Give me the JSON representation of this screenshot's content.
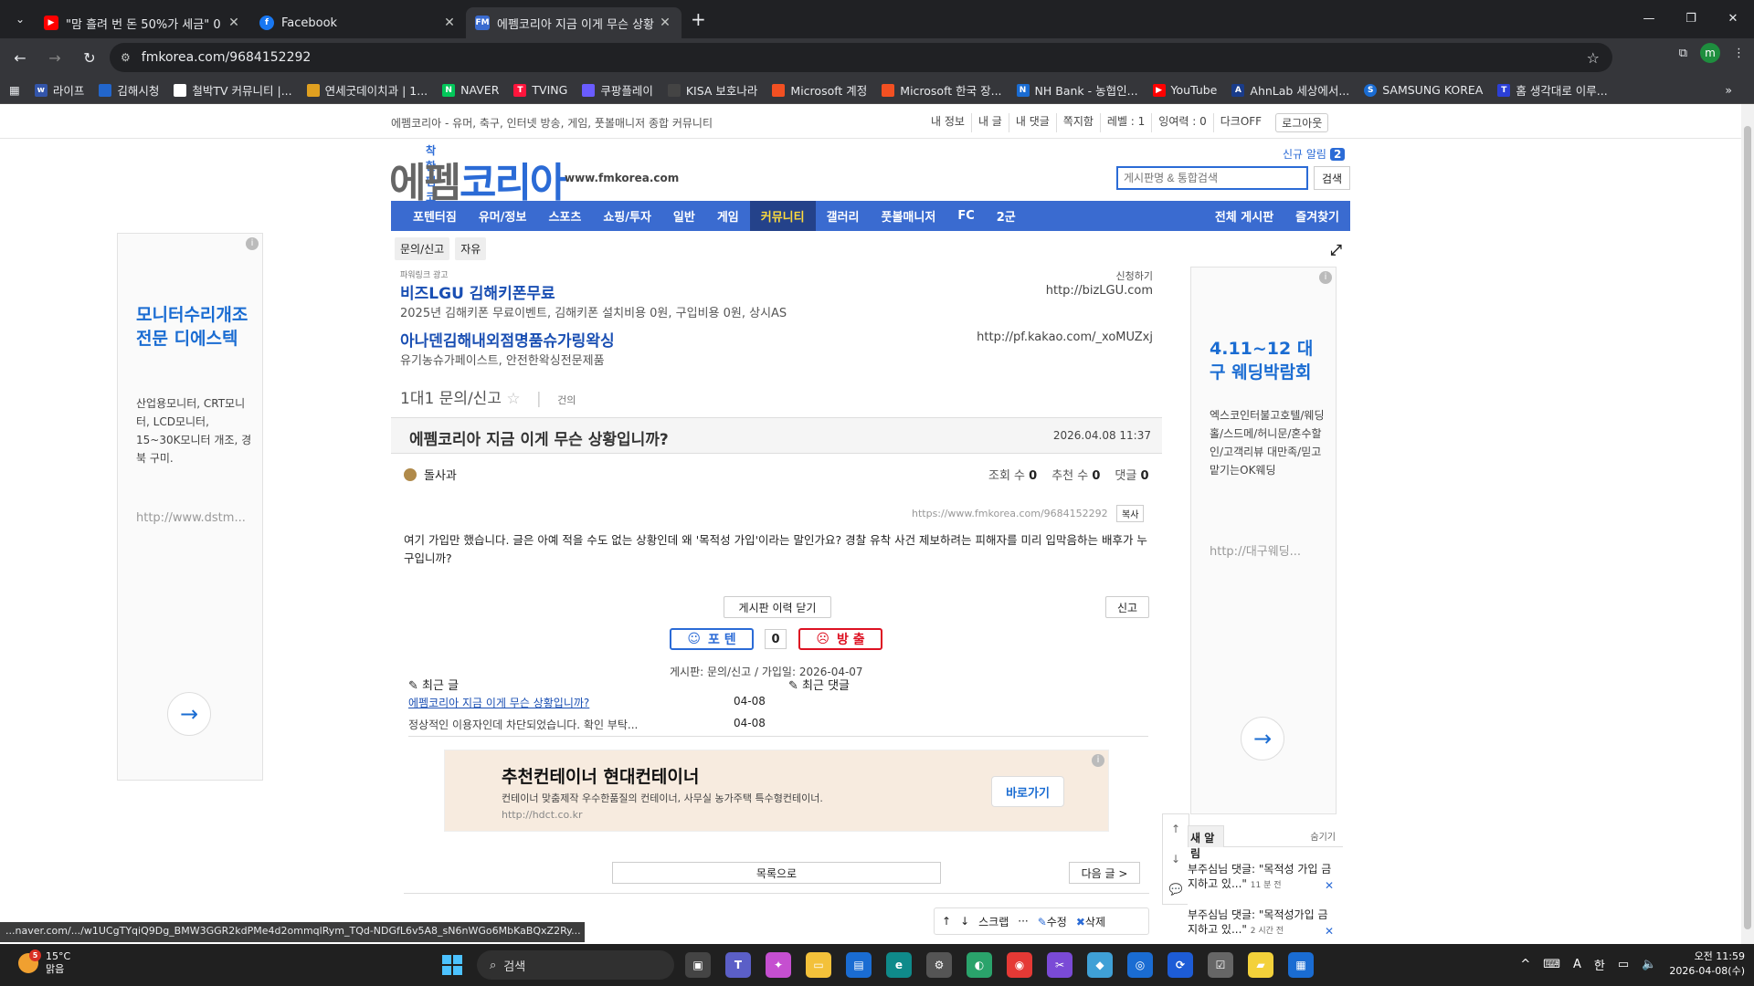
{
  "browser": {
    "tabs": [
      {
        "title": "\"맘 흘려 번 돈 50%가 세금\" 0",
        "icon": "youtube-icon",
        "color": "#ff0000"
      },
      {
        "title": "Facebook",
        "icon": "facebook-icon",
        "color": "#1877f2"
      },
      {
        "title": "에펨코리아 지금 이게 무슨 상황",
        "icon": "fmkorea-icon",
        "color": "#3a6bd0",
        "active": true
      }
    ],
    "url": "fmkorea.com/9684152292",
    "profile": "m",
    "bookmarks": [
      {
        "label": "라이프",
        "color": "#3355aa",
        "glyph": "ww"
      },
      {
        "label": "김해시청",
        "color": "#2266cc",
        "glyph": ""
      },
      {
        "label": "철박TV 커뮤니티 |...",
        "color": "#fff",
        "glyph": ""
      },
      {
        "label": "연세굿데이치과 | 1...",
        "color": "#e0a020",
        "glyph": ""
      },
      {
        "label": "NAVER",
        "color": "#03c75a",
        "glyph": "N"
      },
      {
        "label": "TVING",
        "color": "#ff153c",
        "glyph": "T"
      },
      {
        "label": "쿠팡플레이",
        "color": "#6a5cff",
        "glyph": ""
      },
      {
        "label": "KISA 보호나라",
        "color": "#444",
        "glyph": ""
      },
      {
        "label": "Microsoft 계정",
        "color": "#f25022",
        "glyph": ""
      },
      {
        "label": "Microsoft 한국  장...",
        "color": "#f25022",
        "glyph": ""
      },
      {
        "label": "NH Bank - 농협인...",
        "color": "#1a6cd2",
        "glyph": "NH"
      },
      {
        "label": "YouTube",
        "color": "#ff0000",
        "glyph": ""
      },
      {
        "label": "AhnLab  세상에서...",
        "color": "#1a3c8a",
        "glyph": "A"
      },
      {
        "label": "SAMSUNG KOREA",
        "color": "#1a6cd2",
        "glyph": "S"
      },
      {
        "label": "홈  생각대로 이루...",
        "color": "#2b3fd6",
        "glyph": "T"
      }
    ],
    "status_url": "...naver.com/.../w1UCgTYqiQ9Dg_BMW3GGR2kdPMe4d2ommqlRym_TQd-NDGfL6v5A8_sN6nWGo6MbKaBQxZ2Ry..."
  },
  "site": {
    "description": "에펨코리아 - 유머, 축구, 인터넷 방송, 게임, 풋볼매니저 종합 커뮤니티",
    "util_links": [
      "내 정보",
      "내 글",
      "내 댓글",
      "쪽지함",
      "레벨 : 1",
      "잉여력 : 0",
      "다크OFF"
    ],
    "logout": "로그아웃",
    "logo_small": "착한 펨코",
    "logo_part1": "에펨",
    "logo_part2": "코리아",
    "logo_url": "www.fmkorea.com",
    "new_alarm_label": "신규 알림",
    "new_alarm_count": "2",
    "search_placeholder": "게시판명 & 통합검색",
    "search_button": "검색",
    "gnb": [
      "포텐터짐",
      "유머/정보",
      "스포츠",
      "쇼핑/투자",
      "일반",
      "게임",
      "커뮤니티",
      "갤러리",
      "풋볼매니저",
      "FC",
      "2군"
    ],
    "gnb_active": "커뮤니티",
    "gnb_right": [
      "전체 게시판",
      "즐겨찾기"
    ],
    "subnav": [
      "문의/신고",
      "자유"
    ]
  },
  "powerlink": {
    "label": "파워링크 광고",
    "apply": "신청하기",
    "ads": [
      {
        "title": "비즈LGU 김해키폰무료",
        "desc": "2025년 김해키폰 무료이벤트, 김해키폰 설치비용 0원, 구입비용 0원, 상시AS",
        "url": "http://bizLGU.com"
      },
      {
        "title": "아나덴김해내외점명품슈가링왁싱",
        "desc": "유기농슈가페이스트, 안전한왁싱전문제품",
        "url": "http://pf.kakao.com/_xoMUZxj"
      }
    ]
  },
  "board": {
    "name": "1대1 문의/신고",
    "suggest": "건의"
  },
  "article": {
    "title": "에펨코리아 지금 이게 무슨 상황입니까?",
    "date": "2026.04.08 11:37",
    "author": "돌사과",
    "views_label": "조회 수",
    "views": "0",
    "recommend_label": "추천 수",
    "recommend": "0",
    "comments_label": "댓글",
    "comments": "0",
    "permalink": "https://www.fmkorea.com/9684152292",
    "copy": "복사",
    "body": "여기 가입만 했습니다.  글은 아예 적을 수도 없는 상황인데 왜 '목적성 가입'이라는 말인가요? 경찰 유착 사건 제보하려는 피해자를 미리 입막음하는 배후가 누구입니까?",
    "history_button": "게시판 이력 닫기",
    "report_button": "신고",
    "vote_up": "포 텐",
    "vote_count": "0",
    "vote_down": "방 출",
    "meta": "게시판: 문의/신고 / 가입일: 2026-04-07",
    "recent_posts_label": "최근 글",
    "recent_comments_label": "최근 댓글",
    "recent_posts": [
      {
        "title": "에펨코리아 지금 이게 무슨 상황입니까?",
        "date": "04-08"
      },
      {
        "title": "정상적인 이용자인데 차단되었습니다. 확인 부탁...",
        "date": "04-08"
      }
    ],
    "list_button": "목록으로",
    "next_button": "다음 글 >",
    "toolbar": [
      "스크랩",
      "···",
      "수정",
      "삭제"
    ]
  },
  "ads": {
    "left": {
      "title": "모니터수리개조 전문 디에스텍",
      "text": "산업용모니터, CRT모니터, LCD모니터, 15~30K모니터 개조, 경북 구미.",
      "url": "http://www.dstm..."
    },
    "right": {
      "title": "4.11~12 대구 웨딩박람회",
      "text": "엑스코인터불고호텔/웨딩홀/스드메/허니문/혼수할인/고객리뷰 대만족/믿고맡기는OK웨딩",
      "url": "http://대구웨딩..."
    },
    "banner": {
      "title": "추천컨테이너 현대컨테이너",
      "desc": "컨테이너 맞춤제작 우수한품질의 컨테이너, 사무실 농가주택 특수형컨테이너.",
      "url": "http://hdct.co.kr",
      "cta": "바로가기"
    }
  },
  "notifications": {
    "tab": "새 알림",
    "hide": "숨기기",
    "items": [
      {
        "text": "부주심님 댓글: \"목적성 가입 금지하고 있...\"",
        "time": "11 분 전"
      },
      {
        "text": "부주심님 댓글: \"목적성가입 금지하고 있...\"",
        "time": "2 시간 전"
      }
    ]
  },
  "taskbar": {
    "temp": "15°C",
    "weather": "맑음",
    "weather_badge": "5",
    "search": "검색",
    "time": "오전 11:59",
    "date": "2026-04-08(수)",
    "ime": "한",
    "lang": "A"
  }
}
